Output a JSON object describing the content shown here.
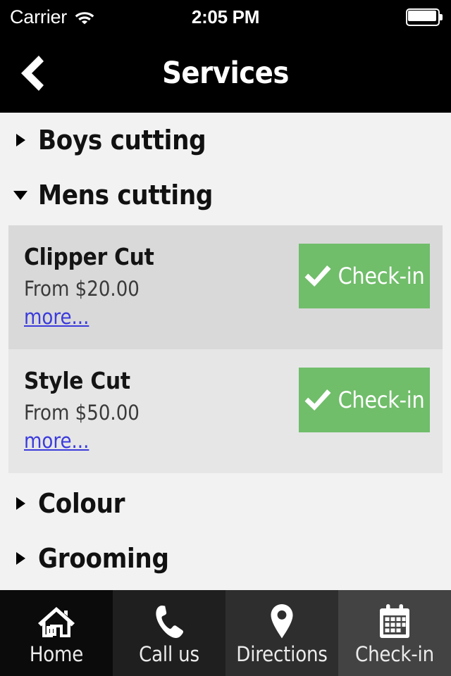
{
  "status_bar": {
    "carrier": "Carrier",
    "wifi_icon": "wifi-icon",
    "time": "2:05 PM",
    "battery_icon": "battery-full-icon"
  },
  "nav_bar": {
    "back_icon": "back-chevron-icon",
    "title": "Services"
  },
  "colors": {
    "accent_green": "#70bd6a",
    "link_blue": "#3b3bdc",
    "page_background": "#f2f2f3",
    "bar_background": "#000000",
    "row_a": "#d9d9da",
    "row_b": "#e6e6e7"
  },
  "sections": [
    {
      "label": "Boys cutting",
      "expanded": false,
      "toggle_icon": "triangle-right-icon"
    },
    {
      "label": "Mens cutting",
      "expanded": true,
      "toggle_icon": "triangle-down-icon"
    },
    {
      "label": "Colour",
      "expanded": false,
      "toggle_icon": "triangle-right-icon"
    },
    {
      "label": "Grooming",
      "expanded": false,
      "toggle_icon": "triangle-right-icon"
    }
  ],
  "services": [
    {
      "name": "Clipper Cut",
      "price": "From $20.00",
      "more_label": "more...",
      "button_label": "Check-in",
      "button_icon": "checkmark-icon"
    },
    {
      "name": "Style Cut",
      "price": "From $50.00",
      "more_label": "more...",
      "button_label": "Check-in",
      "button_icon": "checkmark-icon"
    }
  ],
  "tab_bar": {
    "items": [
      {
        "label": "Home",
        "icon": "home-icon",
        "background": "#0b0b0b"
      },
      {
        "label": "Call us",
        "icon": "phone-icon",
        "background": "#1f1f1f"
      },
      {
        "label": "Directions",
        "icon": "map-pin-icon",
        "background": "#2e2e2e"
      },
      {
        "label": "Check-in",
        "icon": "calendar-icon",
        "background": "#434343"
      }
    ]
  }
}
